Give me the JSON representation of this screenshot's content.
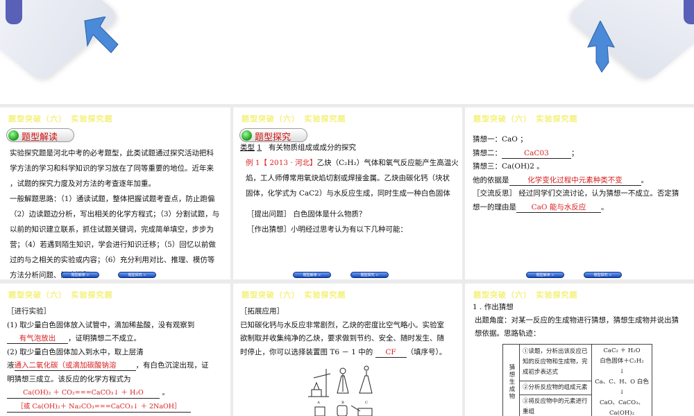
{
  "header": "题型突破（六）　实验探究题",
  "nav": {
    "prev": "题型解读  >",
    "next": "题型探究  >"
  },
  "colors": {
    "header": "#f4f07a",
    "answer": "#d82020",
    "nav": "#1a48b8"
  },
  "slide1": {
    "pill": "题型解读",
    "lines": [
      "实验探究题是河北中考的必考题型，此类试题通过探究活动把科",
      "学方法的学习和科学知识的学习放在了同等重要的地位。近年来",
      "，试题的探究力度及对方法的考查逐年加重。",
      "一般解题思路：（1）通读试题，整体把握试题考查点，防止跑偏",
      "（2）边读题边分析，写出相关的化学方程式；（3）分割试题，与",
      "以前的知识建立联系，抓住试题关键词，完成简单填空，步步为",
      "营；（4）若遇到陌生知识，学会进行知识迁移；（5）回忆以前做",
      "过的与之相关的实验或内容；（6）充分利用对比、推理、模仿等",
      "方法分析问题、解决问题。"
    ]
  },
  "slide2": {
    "pill": "题型探究",
    "type_label": "类型",
    "type_num": "1",
    "type_title": "有关物质组成或成分的探究",
    "example": "例 1【 2013 · 河北】",
    "line1": "乙炔（C₂H₂）气体和氧气反应能产生高温火",
    "line2": "焰，工人师傅常用氧炔焰切割或焊接金属。乙炔由碳化钙（块状",
    "line3": "固体，化学式为  CaC2）与水反应生成，同时生成一种白色固体",
    "q1": "［提出问题］ 白色固体是什么物质？",
    "q2": "［作出猜想］小明经过思考认为有以下几种可能："
  },
  "slide3": {
    "g1": "猜想一：CaO ；",
    "g2_label": "猜想二：",
    "g2_ans": "CaC03",
    "g2_end": "；",
    "g3": "猜想三：Ca(OH)2 。",
    "basis_label": "他的依据是",
    "basis_ans": "化学变化过程中元素种类不变",
    "basis_end": "。",
    "reflect": "［交流反思］ 经过同学们交流讨论，认为猜想一不成立。否定猜",
    "reason_label": "想一的理由是",
    "reason_ans": "CaO 能与水反应",
    "reason_end": "。"
  },
  "slide4": {
    "title": "［进行实验］",
    "s1": "(1) 取少量白色固体放入试管中，滴加稀盐酸，没有观察到",
    "s1_ans": "有气泡放出",
    "s1_end": "，证明猜想二不成立。",
    "s2": "(2) 取少量白色固体加入到水中，取上层清",
    "s2_pre": "液",
    "s2_ans": "通入二氧化碳（或滴加碳酸钠溶",
    "s2_end": "，有白色沉淀出现，证",
    "s3": "明猜想三成立。该反应的化学方程式为",
    "eq1": "Ca(OH)₂ ＋ CO₂===CaCO₃↓ ＋ H₂O",
    "eq1_end": "。",
    "eq2": "［或 Ca(OH)₂＋ Na₂CO₃===CaCO₃↓ ＋ 2NaOH］"
  },
  "slide5": {
    "title": "［拓展应用］",
    "l1": "已知碳化钙与水反应非常剧烈，乙炔的密度比空气略小。实验室",
    "l2": "欲制取并收集纯净的乙炔，要求做到节约、安全、随时发生、随",
    "l3": "时停止，你可以选择装置图 T6 － 1 中的",
    "ans": "CF",
    "l3_end": "（填序号）。",
    "labels": [
      "A",
      "B",
      "C"
    ]
  },
  "slide6": {
    "title": "1 . 作出猜想",
    "l1": "出题角度：对某一反应的生成物进行猜想，猜想生成物并说出猜",
    "l2": "想依据。思路轨迹：",
    "side": "猜想生成物",
    "steps": [
      "①读题，分析出该反应已知的反应物和生成物，完成初步表达式",
      "②分析反应物的组成元素",
      "③将反应物中的元素进行重组"
    ],
    "flow": [
      "CaC₂ ＋ H₂O",
      "白色固体＋C₂H₂",
      "Ca、C、H、O  白色",
      "CaO、CaCO₃、",
      "Ca(OH)₂"
    ]
  }
}
